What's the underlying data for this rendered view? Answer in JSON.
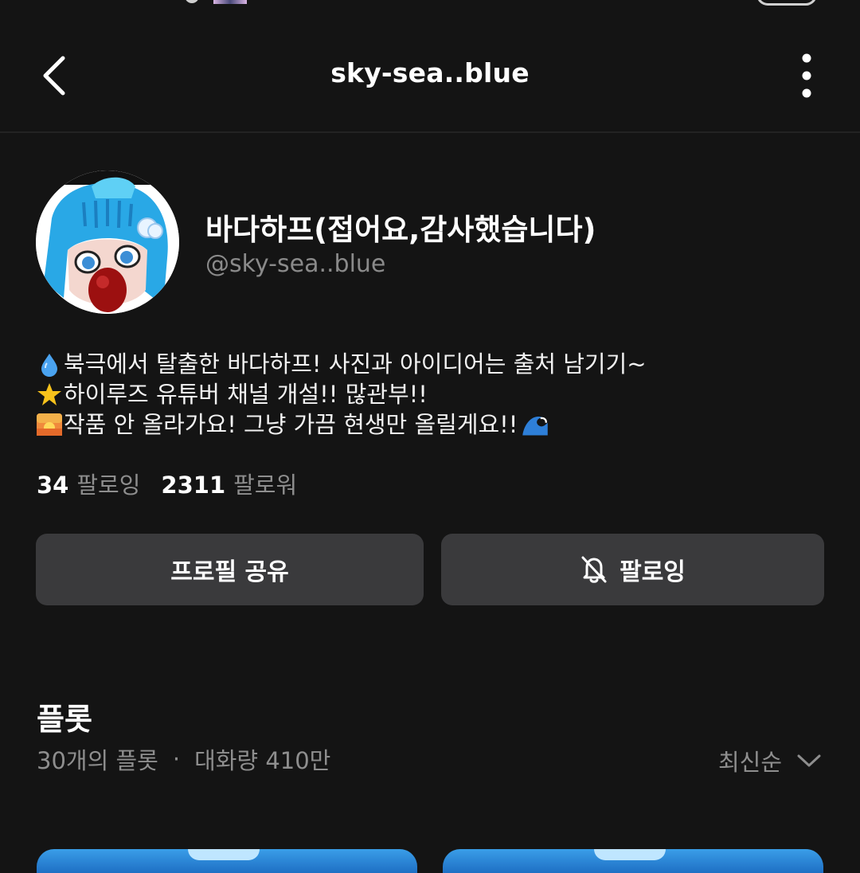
{
  "header": {
    "title": "sky-sea..blue"
  },
  "profile": {
    "display_name": "바다하프(접어요,감사했습니다)",
    "handle": "@sky-sea..blue"
  },
  "bio": [
    {
      "emoji": "droplet-icon",
      "text": "북극에서 탈출한 바다하프! 사진과 아이디어는 출처 남기기~"
    },
    {
      "emoji": "star-icon",
      "text": "하이루즈 유튜버 채널 개설!! 많관부!!"
    },
    {
      "emoji": "sunrise-icon",
      "text": "작품 안 올라가요! 그냥 가끔 현생만 올릴게요!!",
      "trailing_emoji": "wave-icon"
    }
  ],
  "stats": {
    "following_count": "34",
    "following_label": "팔로잉",
    "followers_count": "2311",
    "followers_label": "팔로워"
  },
  "actions": {
    "share_label": "프로필 공유",
    "follow_label": "팔로잉"
  },
  "section": {
    "title": "플롯",
    "count_text": "30개의 플롯",
    "separator": "·",
    "conversation_text": "대화량 410만",
    "sort_label": "최신순"
  },
  "colors": {
    "background": "#141414",
    "button_bg": "#3a3a3c",
    "muted_text": "#8e8e8e",
    "card_blue": "#3a9ee8"
  }
}
